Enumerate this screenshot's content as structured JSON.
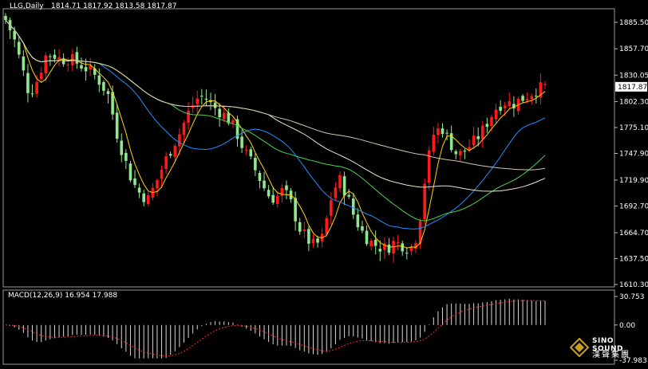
{
  "header": {
    "main_label": "LLG,Daily",
    "ohlc": "1814.71 1817.92 1813.58 1817.87",
    "macd_label": "MACD(12,26,9) 16.954 17.988"
  },
  "price_axis": {
    "ticks": [
      "1885.50",
      "1857.70",
      "1830.05",
      "1802.30",
      "1775.10",
      "1747.90",
      "1719.90",
      "1692.70",
      "1664.70",
      "1637.50",
      "1610.30"
    ],
    "current_price": "1817.87"
  },
  "macd_axis": {
    "ticks": [
      "30.753",
      "0.00",
      "-37.983"
    ]
  },
  "logo": {
    "word": "SINO SOUND",
    "cn": "漢聲集團"
  },
  "colors": {
    "up": "#ff1a1a",
    "down": "#8ee88e",
    "ma_fast": "#ffd400",
    "ma_mid1": "#1e90ff",
    "ma_mid2": "#4bd24b",
    "ma_slow1": "#f0e6c8",
    "ma_slow2": "#d2c8a8",
    "signal": "#ff2a2a",
    "hist": "#d8d8d8"
  },
  "chart_data": {
    "type": "candlestick",
    "series_close": [
      1888,
      1870,
      1840,
      1810,
      1825,
      1850,
      1852,
      1846,
      1848,
      1843,
      1838,
      1832,
      1822,
      1808,
      1770,
      1742,
      1718,
      1705,
      1700,
      1718,
      1738,
      1755,
      1770,
      1790,
      1805,
      1808,
      1798,
      1792,
      1785,
      1772,
      1752,
      1738,
      1722,
      1705,
      1700,
      1710,
      1695,
      1670,
      1658,
      1650,
      1660,
      1700,
      1722,
      1705,
      1680,
      1665,
      1655,
      1650,
      1648,
      1655,
      1652,
      1647,
      1665,
      1730,
      1770,
      1775,
      1760,
      1745,
      1752,
      1760,
      1770,
      1785,
      1798,
      1802,
      1800,
      1805,
      1810,
      1815,
      1818
    ],
    "y_range": [
      1610.3,
      1885.5
    ],
    "macd_range": [
      -37.983,
      30.753
    ]
  }
}
